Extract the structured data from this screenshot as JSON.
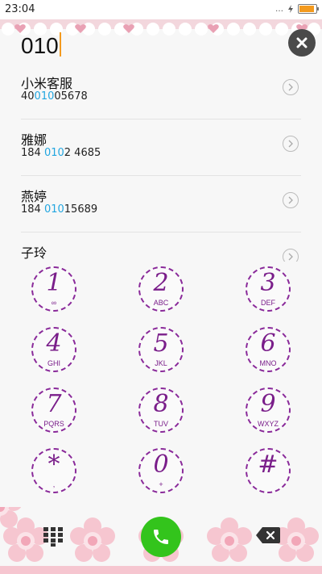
{
  "status_bar": {
    "time": "23:04",
    "signal_glyph": "…",
    "battery_level": 0.9,
    "battery_color": "#f39a1e"
  },
  "search": {
    "query": "010"
  },
  "colors": {
    "accent": "#22a6e0",
    "keypad": "#7a1e8a",
    "call": "#33c41c"
  },
  "contacts": [
    {
      "name": "小米客服",
      "number_pre": "40",
      "number_match": "010",
      "number_post": "05678"
    },
    {
      "name": "雅娜",
      "number_pre": "184 ",
      "number_match": "010",
      "number_post": "2 4685"
    },
    {
      "name": "燕婷",
      "number_pre": "184 ",
      "number_match": "010",
      "number_post": "15689"
    },
    {
      "name": "子玲",
      "number_pre": "",
      "number_match": "",
      "number_post": ""
    }
  ],
  "keypad": [
    {
      "digit": "1",
      "letters": "∞"
    },
    {
      "digit": "2",
      "letters": "ABC"
    },
    {
      "digit": "3",
      "letters": "DEF"
    },
    {
      "digit": "4",
      "letters": "GHI"
    },
    {
      "digit": "5",
      "letters": "JKL"
    },
    {
      "digit": "6",
      "letters": "MNO"
    },
    {
      "digit": "7",
      "letters": "PQRS"
    },
    {
      "digit": "8",
      "letters": "TUV"
    },
    {
      "digit": "9",
      "letters": "WXYZ"
    },
    {
      "digit": "*",
      "letters": ","
    },
    {
      "digit": "0",
      "letters": "+"
    },
    {
      "digit": "#",
      "letters": ""
    }
  ],
  "icons": {
    "clear": "close-icon",
    "dialpad": "dialpad-grid-icon",
    "call": "phone-icon",
    "delete": "backspace-icon"
  }
}
